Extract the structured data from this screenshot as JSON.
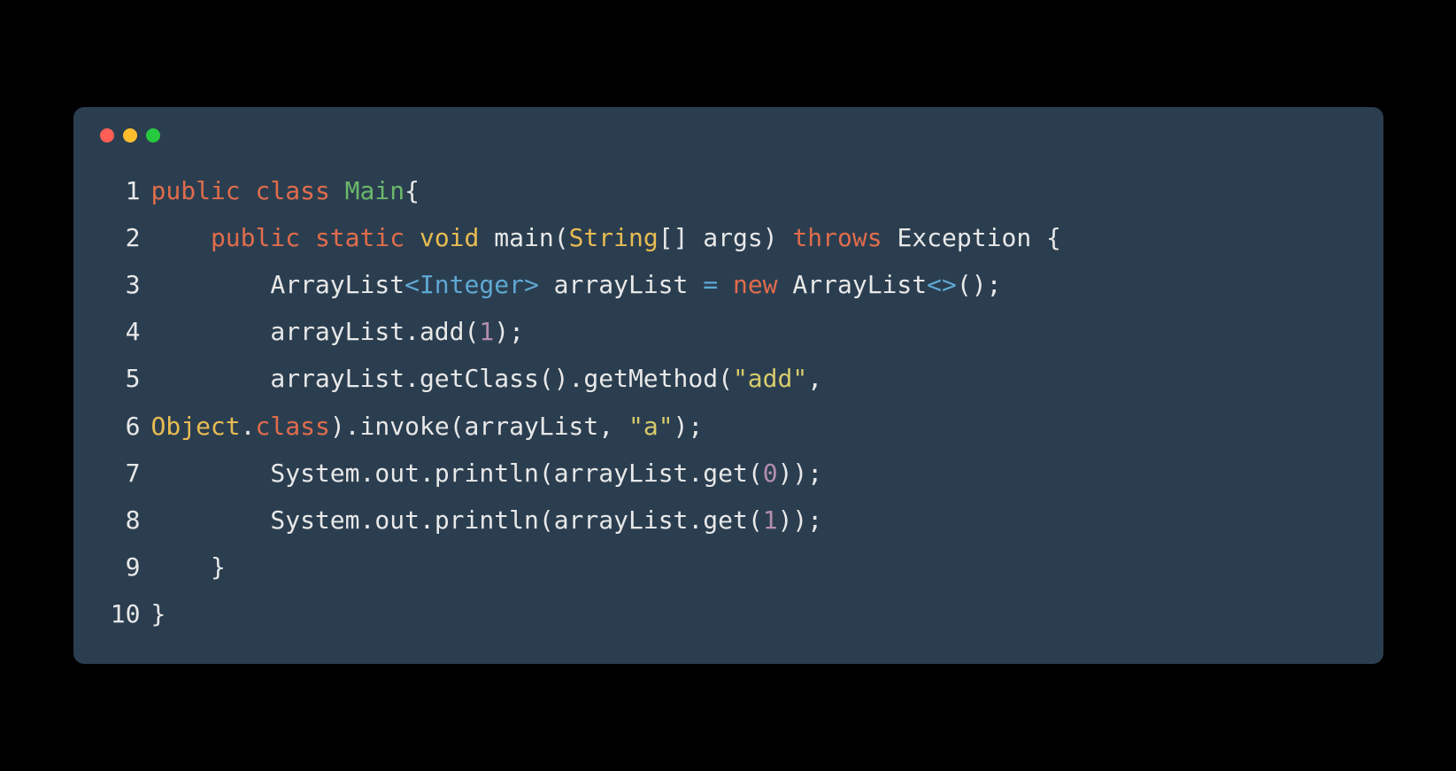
{
  "window": {
    "controls": {
      "close": "close",
      "minimize": "minimize",
      "maximize": "maximize"
    }
  },
  "code": {
    "lines": [
      {
        "num": "1"
      },
      {
        "num": "2"
      },
      {
        "num": "3"
      },
      {
        "num": "4"
      },
      {
        "num": "5"
      },
      {
        "num": "6"
      },
      {
        "num": "7"
      },
      {
        "num": "8"
      },
      {
        "num": "9"
      },
      {
        "num": "10"
      }
    ],
    "tokens": {
      "kw_public": "public",
      "kw_class": "class",
      "kw_static": "static",
      "kw_void": "void",
      "kw_throws": "throws",
      "kw_new": "new",
      "type_Main": "Main",
      "type_String": "String",
      "type_Exception": "Exception",
      "type_ArrayList": "ArrayList",
      "type_Integer": "Integer",
      "type_Object": "Object",
      "ident_main": "main",
      "ident_args": "args",
      "ident_arrayList": "arrayList",
      "ident_System": "System",
      "ident_out": "out",
      "method_add": "add",
      "method_getClass": "getClass",
      "method_getMethod": "getMethod",
      "method_invoke": "invoke",
      "method_println": "println",
      "method_get": "get",
      "prop_class": "class",
      "str_add": "\"add\"",
      "str_a": "\"a\"",
      "num_1": "1",
      "num_0": "0",
      "brace_open": "{",
      "brace_close": "}",
      "paren_open": "(",
      "paren_close": ")",
      "bracket_open": "[",
      "bracket_close": "]",
      "angle_open": "<",
      "angle_close": ">",
      "semicolon": ";",
      "comma": ",",
      "dot": ".",
      "equals": "=",
      "empty_generic": "<>",
      "brackets": "[]",
      "indent1": "    ",
      "indent2": "        ",
      "space": " "
    }
  }
}
